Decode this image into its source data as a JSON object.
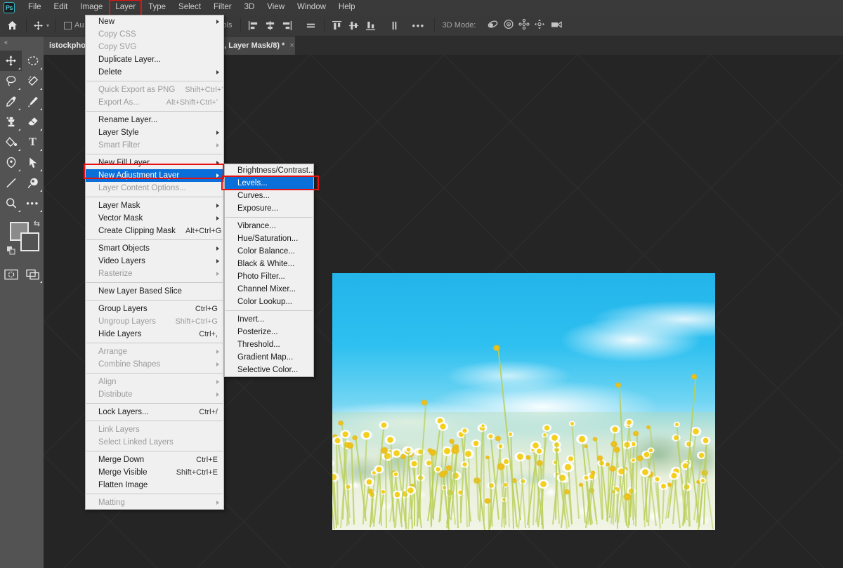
{
  "app": {
    "name": "Adobe Photoshop",
    "logo_text": "Ps",
    "accent": "#3bb3c3",
    "highlight_blue": "#0a6fd8",
    "annotation_red": "#e81111"
  },
  "menubar": {
    "items": [
      {
        "label": "File",
        "active": false
      },
      {
        "label": "Edit",
        "active": false
      },
      {
        "label": "Image",
        "active": false
      },
      {
        "label": "Layer",
        "active": true
      },
      {
        "label": "Type",
        "active": false
      },
      {
        "label": "Select",
        "active": false
      },
      {
        "label": "Filter",
        "active": false
      },
      {
        "label": "3D",
        "active": false
      },
      {
        "label": "View",
        "active": false
      },
      {
        "label": "Window",
        "active": false
      },
      {
        "label": "Help",
        "active": false
      }
    ]
  },
  "optionsbar": {
    "home_icon": "home-icon",
    "tool_icon": "move-tool-icon",
    "chevron": "chevron-down-icon",
    "auto_select_label": "Au",
    "controls_label": "ontrols",
    "align_icons": [
      "align-left-edges-icon",
      "align-horizontal-centers-icon",
      "align-right-edges-icon",
      "distribute-horizontal-icon",
      "align-top-edges-icon",
      "align-vertical-centers-icon",
      "align-bottom-edges-icon",
      "distribute-vertical-icon"
    ],
    "more_label": "•••",
    "three_d_label": "3D Mode:",
    "three_d_icons": [
      "orbit-3d-icon",
      "roll-3d-icon",
      "pan-3d-icon",
      "slide-3d-icon",
      "camera-3d-icon"
    ]
  },
  "tabs": [
    {
      "label": "istockpho",
      "name": "tab-istockphoto"
    },
    {
      "label": "1, Layer Mask/8) *",
      "close": "×",
      "name": "tab-layer-mask-doc"
    }
  ],
  "toolpanel": {
    "collapse_label": "«",
    "tools": [
      {
        "name": "move-tool-icon",
        "glyph": "✥",
        "selected": true
      },
      {
        "name": "elliptical-marquee-icon",
        "glyph": "◌",
        "selected": false
      },
      {
        "name": "lasso-tool-icon",
        "glyph": "◯",
        "selected": false
      },
      {
        "name": "quick-selection-icon",
        "glyph": "❧",
        "selected": false
      },
      {
        "name": "eyedropper-tool-icon",
        "glyph": "⚲",
        "selected": false
      },
      {
        "name": "healing-brush-icon",
        "glyph": "✎",
        "selected": false
      },
      {
        "name": "clone-stamp-icon",
        "glyph": "⚑",
        "selected": false
      },
      {
        "name": "eraser-tool-icon",
        "glyph": "◣",
        "selected": false
      },
      {
        "name": "paint-bucket-icon",
        "glyph": "⬤",
        "selected": false
      },
      {
        "name": "type-tool-icon",
        "glyph": "T",
        "selected": false
      },
      {
        "name": "pen-tool-icon",
        "glyph": "✒",
        "selected": false
      },
      {
        "name": "path-selection-icon",
        "glyph": "➤",
        "selected": false
      },
      {
        "name": "line-tool-icon",
        "glyph": "╱",
        "selected": false
      },
      {
        "name": "dodge-tool-icon",
        "glyph": "◉",
        "selected": false
      },
      {
        "name": "zoom-tool-icon",
        "glyph": "⚲",
        "selected": false
      },
      {
        "name": "edit-toolbar-icon",
        "glyph": "•••",
        "selected": false
      }
    ],
    "swatches": {
      "foreground_color": "#8a8a8a",
      "background_color": "#535353",
      "swap_icon": "swap-colors-icon",
      "default_icon": "default-colors-icon"
    },
    "bottom_tools": [
      {
        "name": "quick-mask-icon",
        "glyph": "◱"
      },
      {
        "name": "screen-mode-icon",
        "glyph": "❐"
      }
    ]
  },
  "layer_menu": {
    "title": "Layer",
    "items": [
      {
        "label": "New",
        "shortcut": "",
        "disabled": false,
        "submenu": true,
        "sep_after": false
      },
      {
        "label": "Copy CSS",
        "shortcut": "",
        "disabled": true,
        "submenu": false,
        "sep_after": false
      },
      {
        "label": "Copy SVG",
        "shortcut": "",
        "disabled": true,
        "submenu": false,
        "sep_after": false
      },
      {
        "label": "Duplicate Layer...",
        "shortcut": "",
        "disabled": false,
        "submenu": false,
        "sep_after": false
      },
      {
        "label": "Delete",
        "shortcut": "",
        "disabled": false,
        "submenu": true,
        "sep_after": true
      },
      {
        "label": "Quick Export as PNG",
        "shortcut": "Shift+Ctrl+'",
        "disabled": true,
        "submenu": false,
        "sep_after": false
      },
      {
        "label": "Export As...",
        "shortcut": "Alt+Shift+Ctrl+'",
        "disabled": true,
        "submenu": false,
        "sep_after": true
      },
      {
        "label": "Rename Layer...",
        "shortcut": "",
        "disabled": false,
        "submenu": false,
        "sep_after": false
      },
      {
        "label": "Layer Style",
        "shortcut": "",
        "disabled": false,
        "submenu": true,
        "sep_after": false
      },
      {
        "label": "Smart Filter",
        "shortcut": "",
        "disabled": true,
        "submenu": true,
        "sep_after": true
      },
      {
        "label": "New Fill Layer",
        "shortcut": "",
        "disabled": false,
        "submenu": true,
        "sep_after": false
      },
      {
        "label": "New Adjustment Layer",
        "shortcut": "",
        "disabled": false,
        "submenu": true,
        "sep_after": false,
        "highlighted": true,
        "annotated": true
      },
      {
        "label": "Layer Content Options...",
        "shortcut": "",
        "disabled": true,
        "submenu": false,
        "sep_after": true
      },
      {
        "label": "Layer Mask",
        "shortcut": "",
        "disabled": false,
        "submenu": true,
        "sep_after": false
      },
      {
        "label": "Vector Mask",
        "shortcut": "",
        "disabled": false,
        "submenu": true,
        "sep_after": false
      },
      {
        "label": "Create Clipping Mask",
        "shortcut": "Alt+Ctrl+G",
        "disabled": false,
        "submenu": false,
        "sep_after": true
      },
      {
        "label": "Smart Objects",
        "shortcut": "",
        "disabled": false,
        "submenu": true,
        "sep_after": false
      },
      {
        "label": "Video Layers",
        "shortcut": "",
        "disabled": false,
        "submenu": true,
        "sep_after": false
      },
      {
        "label": "Rasterize",
        "shortcut": "",
        "disabled": true,
        "submenu": true,
        "sep_after": true
      },
      {
        "label": "New Layer Based Slice",
        "shortcut": "",
        "disabled": false,
        "submenu": false,
        "sep_after": true
      },
      {
        "label": "Group Layers",
        "shortcut": "Ctrl+G",
        "disabled": false,
        "submenu": false,
        "sep_after": false
      },
      {
        "label": "Ungroup Layers",
        "shortcut": "Shift+Ctrl+G",
        "disabled": true,
        "submenu": false,
        "sep_after": false
      },
      {
        "label": "Hide Layers",
        "shortcut": "Ctrl+,",
        "disabled": false,
        "submenu": false,
        "sep_after": true
      },
      {
        "label": "Arrange",
        "shortcut": "",
        "disabled": true,
        "submenu": true,
        "sep_after": false
      },
      {
        "label": "Combine Shapes",
        "shortcut": "",
        "disabled": true,
        "submenu": true,
        "sep_after": true
      },
      {
        "label": "Align",
        "shortcut": "",
        "disabled": true,
        "submenu": true,
        "sep_after": false
      },
      {
        "label": "Distribute",
        "shortcut": "",
        "disabled": true,
        "submenu": true,
        "sep_after": true
      },
      {
        "label": "Lock Layers...",
        "shortcut": "Ctrl+/",
        "disabled": false,
        "submenu": false,
        "sep_after": true
      },
      {
        "label": "Link Layers",
        "shortcut": "",
        "disabled": true,
        "submenu": false,
        "sep_after": false
      },
      {
        "label": "Select Linked Layers",
        "shortcut": "",
        "disabled": true,
        "submenu": false,
        "sep_after": true
      },
      {
        "label": "Merge Down",
        "shortcut": "Ctrl+E",
        "disabled": false,
        "submenu": false,
        "sep_after": false
      },
      {
        "label": "Merge Visible",
        "shortcut": "Shift+Ctrl+E",
        "disabled": false,
        "submenu": false,
        "sep_after": false
      },
      {
        "label": "Flatten Image",
        "shortcut": "",
        "disabled": false,
        "submenu": false,
        "sep_after": true
      },
      {
        "label": "Matting",
        "shortcut": "",
        "disabled": true,
        "submenu": true,
        "sep_after": false
      }
    ]
  },
  "adjustment_submenu": {
    "title": "New Adjustment Layer",
    "items": [
      {
        "label": "Brightness/Contrast...",
        "sep_after": false
      },
      {
        "label": "Levels...",
        "sep_after": false,
        "highlighted": true,
        "annotated": true
      },
      {
        "label": "Curves...",
        "sep_after": false
      },
      {
        "label": "Exposure...",
        "sep_after": true
      },
      {
        "label": "Vibrance...",
        "sep_after": false
      },
      {
        "label": "Hue/Saturation...",
        "sep_after": false
      },
      {
        "label": "Color Balance...",
        "sep_after": false
      },
      {
        "label": "Black & White...",
        "sep_after": false
      },
      {
        "label": "Photo Filter...",
        "sep_after": false
      },
      {
        "label": "Channel Mixer...",
        "sep_after": false
      },
      {
        "label": "Color Lookup...",
        "sep_after": true
      },
      {
        "label": "Invert...",
        "sep_after": false
      },
      {
        "label": "Posterize...",
        "sep_after": false
      },
      {
        "label": "Threshold...",
        "sep_after": false
      },
      {
        "label": "Gradient Map...",
        "sep_after": false
      },
      {
        "label": "Selective Color...",
        "sep_after": false
      }
    ]
  },
  "canvas": {
    "background_color": "#252525",
    "watermark_text": "",
    "document_description": "Photograph of a meadow of white daisy and dandelion flowers with yellow centers under a bright blue sky with white clouds and blurred green trees on the horizon."
  }
}
